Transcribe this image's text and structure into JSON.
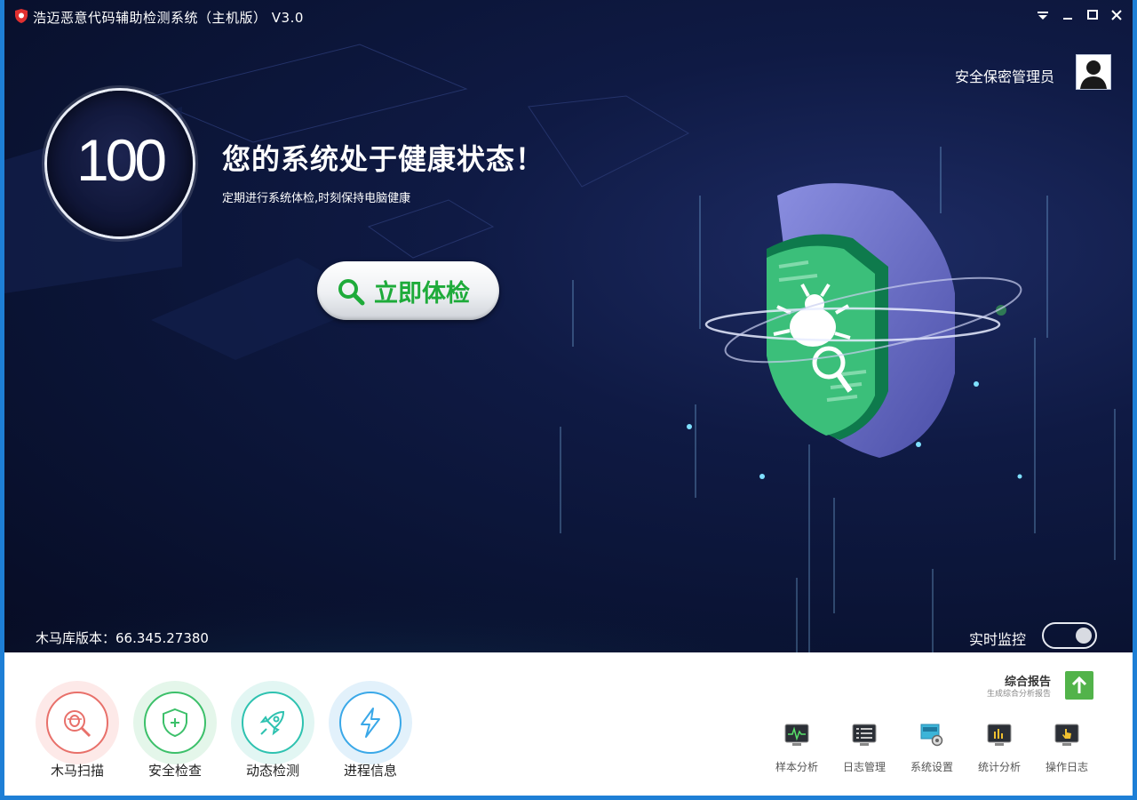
{
  "window": {
    "title": "浩迈恶意代码辅助检测系统（主机版） V3.0",
    "controls": {
      "menu": "▼",
      "minimize": "—",
      "maximize": "□",
      "close": "✕"
    }
  },
  "user": {
    "name": "安全保密管理员",
    "avatar_icon": "user-avatar-icon"
  },
  "status": {
    "score": "100",
    "headline": "您的系统处于健康状态！",
    "subline": "定期进行系统体检,时刻保持电脑健康"
  },
  "scan_button": {
    "label": "立即体检",
    "icon": "search-icon"
  },
  "database": {
    "version_text": "木马库版本：66.345.27380"
  },
  "realtime_monitor": {
    "label": "实时监控",
    "enabled": true
  },
  "tools": [
    {
      "label": "木马扫描",
      "icon": "bug-scan-icon",
      "color": "#e8706a"
    },
    {
      "label": "安全检查",
      "icon": "shield-plus-icon",
      "color": "#3cc06a"
    },
    {
      "label": "动态检测",
      "icon": "rocket-icon",
      "color": "#2ec2b0"
    },
    {
      "label": "进程信息",
      "icon": "lightning-icon",
      "color": "#3aa8e8"
    }
  ],
  "report": {
    "title": "综合报告",
    "subtitle": "生成综合分析报告",
    "icon": "upload-arrow-icon"
  },
  "mini_tools": [
    {
      "label": "样本分析",
      "icon": "waveform-monitor-icon"
    },
    {
      "label": "日志管理",
      "icon": "log-list-icon"
    },
    {
      "label": "系统设置",
      "icon": "soft-gear-icon"
    },
    {
      "label": "统计分析",
      "icon": "bar-stats-icon"
    },
    {
      "label": "操作日志",
      "icon": "hand-touch-icon"
    }
  ],
  "colors": {
    "frame": "#1e7fd6",
    "accent_green": "#1eab3a",
    "hero_bg": "#0b1230"
  }
}
